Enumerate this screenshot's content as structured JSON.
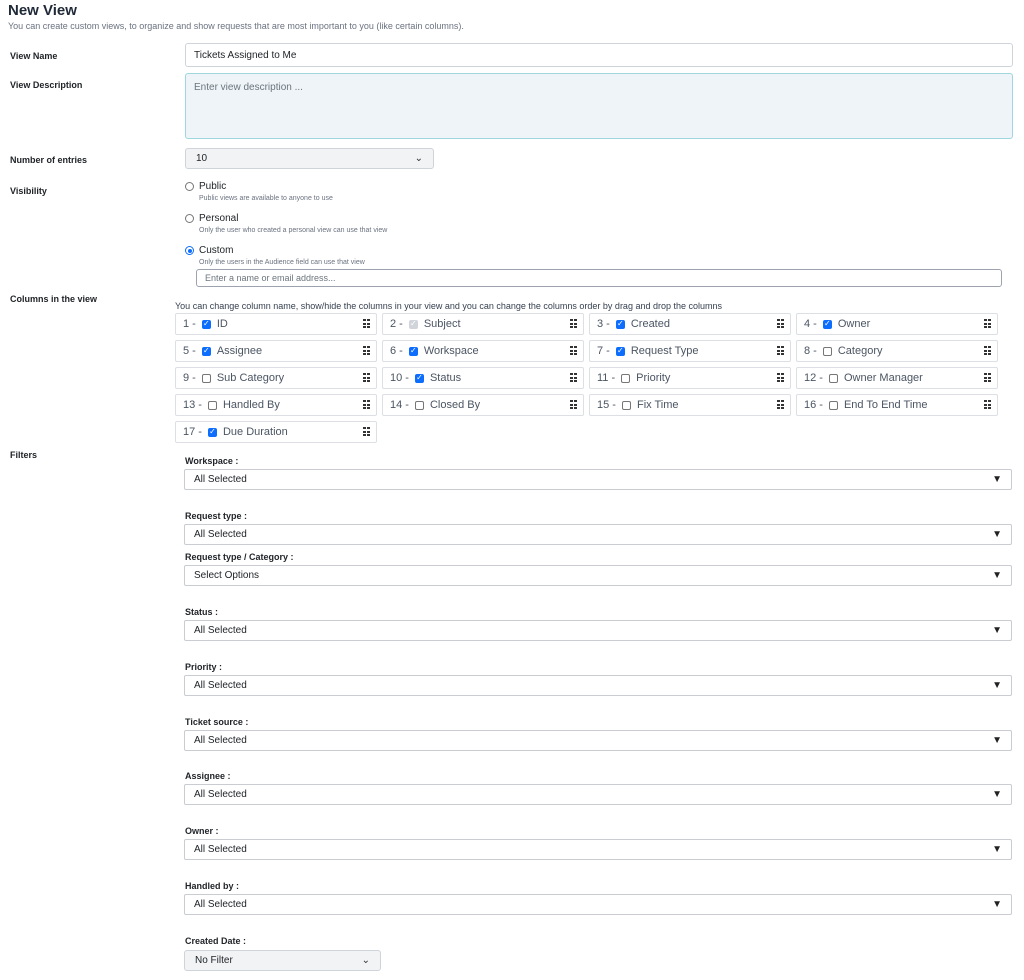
{
  "page": {
    "title": "New View",
    "subtitle": "You can create custom views, to organize and show requests that are most important to you (like certain columns)."
  },
  "form": {
    "view_name_label": "View Name",
    "view_name_value": "Tickets Assigned to Me",
    "view_description_label": "View Description",
    "view_description_placeholder": "Enter view description ...",
    "entries_label": "Number of entries",
    "entries_value": "10",
    "visibility_label": "Visibility",
    "visibility_options": [
      {
        "label": "Public",
        "hint": "Public views are available to anyone to use",
        "selected": false
      },
      {
        "label": "Personal",
        "hint": "Only the user who created a personal view can use that view",
        "selected": false
      },
      {
        "label": "Custom",
        "hint": "Only the users in the Audience field can use that view",
        "selected": true
      }
    ],
    "audience_placeholder": "Enter a name or email address...",
    "columns_label": "Columns in the view",
    "columns_hint": "You can change column name, show/hide the columns in your view and you can change the columns order by drag and drop the columns",
    "columns": [
      {
        "num": "1 -",
        "name": "ID",
        "checked": true,
        "disabled": false
      },
      {
        "num": "2 -",
        "name": "Subject",
        "checked": true,
        "disabled": true
      },
      {
        "num": "3 -",
        "name": "Created",
        "checked": true,
        "disabled": false
      },
      {
        "num": "4 -",
        "name": "Owner",
        "checked": true,
        "disabled": false
      },
      {
        "num": "5 -",
        "name": "Assignee",
        "checked": true,
        "disabled": false
      },
      {
        "num": "6 -",
        "name": "Workspace",
        "checked": true,
        "disabled": false
      },
      {
        "num": "7 -",
        "name": "Request Type",
        "checked": true,
        "disabled": false
      },
      {
        "num": "8 -",
        "name": "Category",
        "checked": false,
        "disabled": false
      },
      {
        "num": "9 -",
        "name": "Sub Category",
        "checked": false,
        "disabled": false
      },
      {
        "num": "10 -",
        "name": "Status",
        "checked": true,
        "disabled": false
      },
      {
        "num": "11 -",
        "name": "Priority",
        "checked": false,
        "disabled": false
      },
      {
        "num": "12 -",
        "name": "Owner Manager",
        "checked": false,
        "disabled": false
      },
      {
        "num": "13 -",
        "name": "Handled By",
        "checked": false,
        "disabled": false
      },
      {
        "num": "14 -",
        "name": "Closed By",
        "checked": false,
        "disabled": false
      },
      {
        "num": "15 -",
        "name": "Fix Time",
        "checked": false,
        "disabled": false
      },
      {
        "num": "16 -",
        "name": "End To End Time",
        "checked": false,
        "disabled": false
      },
      {
        "num": "17 -",
        "name": "Due Duration",
        "checked": true,
        "disabled": false
      }
    ],
    "filters_label": "Filters",
    "filters": [
      {
        "label": "Workspace :",
        "value": "All Selected"
      },
      {
        "label": "Request type :",
        "value": "All Selected"
      },
      {
        "label": "Request type / Category :",
        "value": "Select Options"
      },
      {
        "label": "Status :",
        "value": "All Selected"
      },
      {
        "label": "Priority :",
        "value": "All Selected"
      },
      {
        "label": "Ticket source :",
        "value": "All Selected"
      },
      {
        "label": "Assignee :",
        "value": "All Selected"
      },
      {
        "label": "Owner :",
        "value": "All Selected"
      },
      {
        "label": "Handled by :",
        "value": "All Selected"
      }
    ],
    "created_date_label": "Created Date :",
    "created_date_value": "No Filter"
  },
  "colors": {
    "accent": "#0d6efd",
    "textarea_bg": "#eef4f8",
    "textarea_border": "#9fd7e0"
  }
}
